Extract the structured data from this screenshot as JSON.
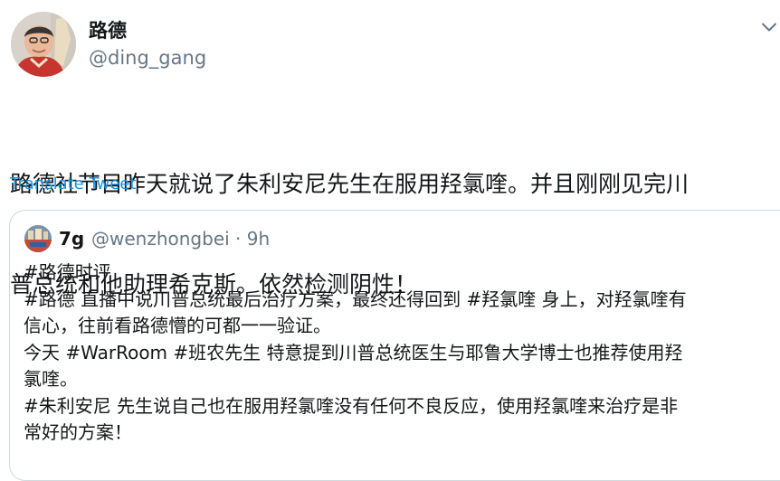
{
  "author": {
    "display_name": "路德",
    "handle": "@ding_gang"
  },
  "tweet": {
    "text_lines": [
      "路德社节目昨天就说了朱利安尼先生在服用羟氯喹。并且刚刚见完川",
      "普总统和他助理希克斯。依然检测阴性！"
    ],
    "translate_label": "Translate Tweet"
  },
  "quoted_tweet": {
    "display_name": "7g",
    "handle": "@wenzhongbei",
    "separator": "·",
    "time": "9h",
    "meta": "@wenzhongbei · 9h",
    "lines": [
      "#路德时评",
      "#路德 直播中说川普总统最后治疗方案，最终还得回到 #羟氯喹 身上，对羟氯喹有",
      "信心，往前看路德懵的可都一一验证。",
      "今天 #WarRoom #班农先生 特意提到川普总统医生与耶鲁大学博士也推荐使用羟",
      "氯喹。",
      "#朱利安尼 先生说自己也在服用羟氯喹没有任何不良反应，使用羟氯喹来治疗是非",
      "常好的方案！"
    ]
  },
  "icons": {
    "more": "chevron-down-icon",
    "avatar": "user-avatar",
    "quoted_avatar": "user-avatar"
  },
  "colors": {
    "text_primary": "#14171a",
    "text_secondary": "#657786",
    "link": "#1b95e0",
    "border": "#cfd9de"
  }
}
